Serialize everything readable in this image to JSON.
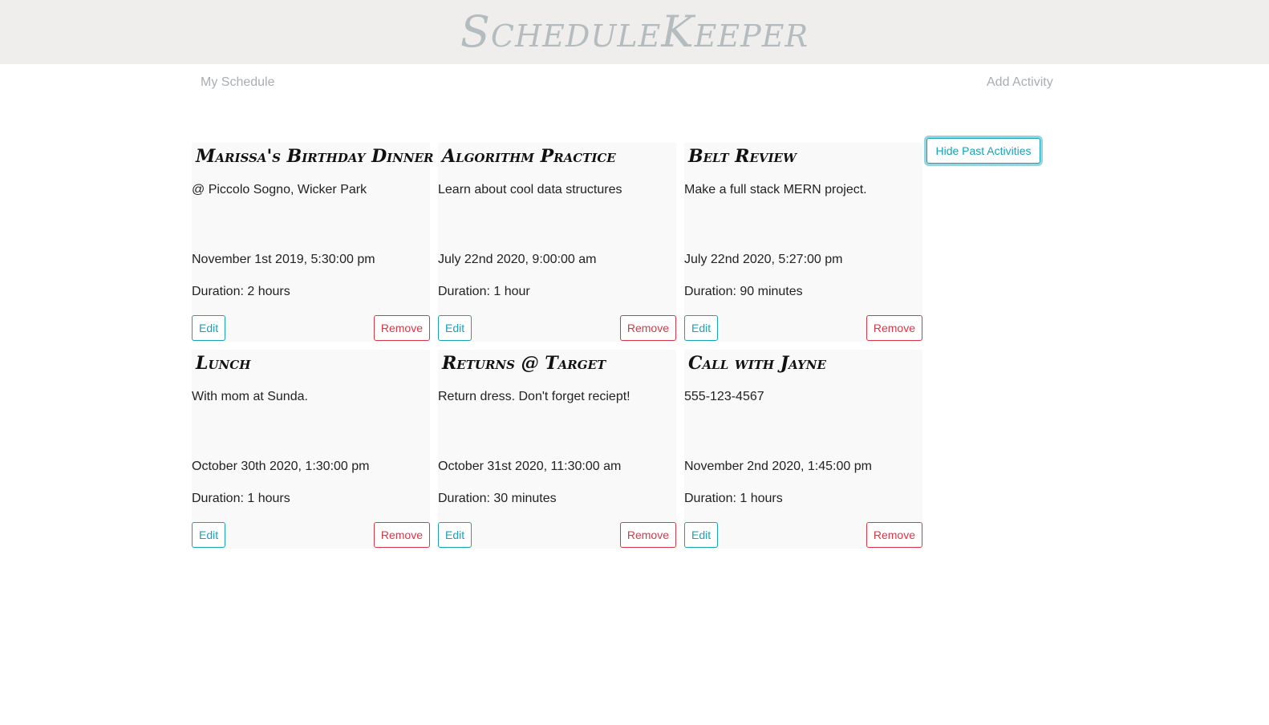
{
  "header": {
    "logo_text": "ScheduleKeeper"
  },
  "nav": {
    "my_schedule": "My Schedule",
    "add_activity": "Add Activity"
  },
  "toolbar": {
    "hide_past_label": "Hide Past Activities"
  },
  "colors": {
    "accent": "#17a2b8",
    "danger": "#dc3545",
    "header_bg": "#efeeed",
    "card_bg": "#f9f9f9"
  },
  "activities": [
    {
      "title": "Marissa's Birthday Dinner",
      "description": "@ Piccolo Sogno, Wicker Park",
      "datetime": "November 1st 2019, 5:30:00 pm",
      "duration": "Duration: 2 hours",
      "edit_label": "Edit",
      "remove_label": "Remove"
    },
    {
      "title": "Algorithm Practice",
      "description": "Learn about cool data structures",
      "datetime": "July 22nd 2020, 9:00:00 am",
      "duration": "Duration: 1 hour",
      "edit_label": "Edit",
      "remove_label": "Remove"
    },
    {
      "title": "Belt Review",
      "description": "Make a full stack MERN project.",
      "datetime": "July 22nd 2020, 5:27:00 pm",
      "duration": "Duration: 90 minutes",
      "edit_label": "Edit",
      "remove_label": "Remove"
    },
    {
      "title": "Lunch",
      "description": "With mom at Sunda.",
      "datetime": "October 30th 2020, 1:30:00 pm",
      "duration": "Duration: 1 hours",
      "edit_label": "Edit",
      "remove_label": "Remove"
    },
    {
      "title": "Returns @ Target",
      "description": "Return dress. Don't forget reciept!",
      "datetime": "October 31st 2020, 11:30:00 am",
      "duration": "Duration: 30 minutes",
      "edit_label": "Edit",
      "remove_label": "Remove"
    },
    {
      "title": "Call with Jayne",
      "description": "555-123-4567",
      "datetime": "November 2nd 2020, 1:45:00 pm",
      "duration": "Duration: 1 hours",
      "edit_label": "Edit",
      "remove_label": "Remove"
    }
  ]
}
